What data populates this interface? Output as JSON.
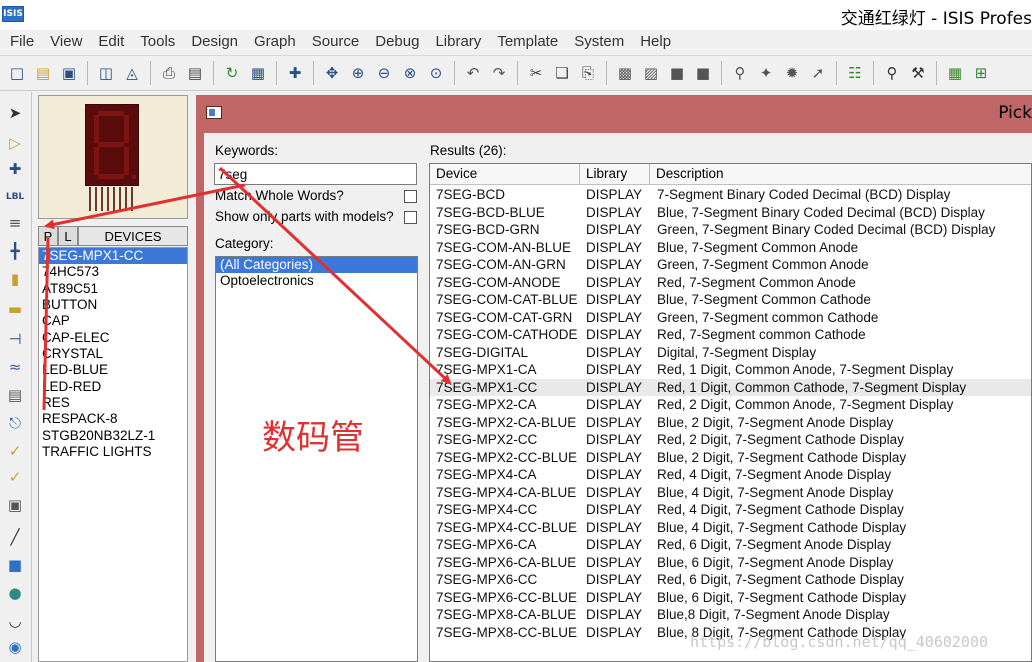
{
  "window": {
    "logo": "ISIS",
    "title": "交通红绿灯 - ISIS Profes"
  },
  "menu": [
    "File",
    "View",
    "Edit",
    "Tools",
    "Design",
    "Graph",
    "Source",
    "Debug",
    "Library",
    "Template",
    "System",
    "Help"
  ],
  "device_selector": {
    "tab_p": "P",
    "tab_l": "L",
    "header": "DEVICES",
    "items": [
      "7SEG-MPX1-CC",
      "74HC573",
      "AT89C51",
      "BUTTON",
      "CAP",
      "CAP-ELEC",
      "CRYSTAL",
      "LED-BLUE",
      "LED-RED",
      "RES",
      "RESPACK-8",
      "STGB20NB32LZ-1",
      "TRAFFIC LIGHTS"
    ],
    "selected_index": 0
  },
  "pick_dialog": {
    "title": "Pick",
    "keywords_label": "Keywords:",
    "keywords_value": "7seg",
    "match_whole_words_label": "Match Whole Words?",
    "match_whole_words_checked": false,
    "show_only_models_label": "Show only parts with models?",
    "show_only_models_checked": false,
    "category_label": "Category:",
    "categories": [
      "(All Categories)",
      "Optoelectronics"
    ],
    "selected_category_index": 0,
    "results_label": "Results (26):",
    "columns": [
      "Device",
      "Library",
      "Description"
    ],
    "highlighted_row_index": 11,
    "rows": [
      {
        "device": "7SEG-BCD",
        "library": "DISPLAY",
        "description": "7-Segment Binary Coded Decimal (BCD) Display"
      },
      {
        "device": "7SEG-BCD-BLUE",
        "library": "DISPLAY",
        "description": "Blue, 7-Segment Binary Coded Decimal (BCD) Display"
      },
      {
        "device": "7SEG-BCD-GRN",
        "library": "DISPLAY",
        "description": "Green, 7-Segment Binary Coded Decimal (BCD) Display"
      },
      {
        "device": "7SEG-COM-AN-BLUE",
        "library": "DISPLAY",
        "description": "Blue, 7-Segment Common Anode"
      },
      {
        "device": "7SEG-COM-AN-GRN",
        "library": "DISPLAY",
        "description": "Green, 7-Segment Common Anode"
      },
      {
        "device": "7SEG-COM-ANODE",
        "library": "DISPLAY",
        "description": "Red, 7-Segment Common Anode"
      },
      {
        "device": "7SEG-COM-CAT-BLUE",
        "library": "DISPLAY",
        "description": "Blue, 7-Segment Common Cathode"
      },
      {
        "device": "7SEG-COM-CAT-GRN",
        "library": "DISPLAY",
        "description": "Green, 7-Segment common Cathode"
      },
      {
        "device": "7SEG-COM-CATHODE",
        "library": "DISPLAY",
        "description": "Red, 7-Segment common Cathode"
      },
      {
        "device": "7SEG-DIGITAL",
        "library": "DISPLAY",
        "description": "Digital, 7-Segment Display"
      },
      {
        "device": "7SEG-MPX1-CA",
        "library": "DISPLAY",
        "description": "Red, 1 Digit, Common Anode, 7-Segment Display"
      },
      {
        "device": "7SEG-MPX1-CC",
        "library": "DISPLAY",
        "description": "Red, 1 Digit, Common Cathode, 7-Segment Display"
      },
      {
        "device": "7SEG-MPX2-CA",
        "library": "DISPLAY",
        "description": "Red, 2 Digit, Common Anode, 7-Segment Display"
      },
      {
        "device": "7SEG-MPX2-CA-BLUE",
        "library": "DISPLAY",
        "description": "Blue, 2 Digit, 7-Segment Anode Display"
      },
      {
        "device": "7SEG-MPX2-CC",
        "library": "DISPLAY",
        "description": "Red, 2 Digit, 7-Segment Cathode Display"
      },
      {
        "device": "7SEG-MPX2-CC-BLUE",
        "library": "DISPLAY",
        "description": "Blue, 2 Digit, 7-Segment Cathode Display"
      },
      {
        "device": "7SEG-MPX4-CA",
        "library": "DISPLAY",
        "description": "Red, 4 Digit, 7-Segment Anode Display"
      },
      {
        "device": "7SEG-MPX4-CA-BLUE",
        "library": "DISPLAY",
        "description": "Blue, 4 Digit, 7-Segment Anode Display"
      },
      {
        "device": "7SEG-MPX4-CC",
        "library": "DISPLAY",
        "description": "Red, 4 Digit, 7-Segment Cathode Display"
      },
      {
        "device": "7SEG-MPX4-CC-BLUE",
        "library": "DISPLAY",
        "description": "Blue, 4 Digit, 7-Segment Cathode Display"
      },
      {
        "device": "7SEG-MPX6-CA",
        "library": "DISPLAY",
        "description": "Red, 6 Digit, 7-Segment Anode Display"
      },
      {
        "device": "7SEG-MPX6-CA-BLUE",
        "library": "DISPLAY",
        "description": "Blue, 6 Digit, 7-Segment Anode Display"
      },
      {
        "device": "7SEG-MPX6-CC",
        "library": "DISPLAY",
        "description": "Red, 6 Digit, 7-Segment Cathode Display"
      },
      {
        "device": "7SEG-MPX6-CC-BLUE",
        "library": "DISPLAY",
        "description": "Blue, 6 Digit, 7-Segment Cathode Display"
      },
      {
        "device": "7SEG-MPX8-CA-BLUE",
        "library": "DISPLAY",
        "description": "Blue,8 Digit, 7-Segment Anode Display"
      },
      {
        "device": "7SEG-MPX8-CC-BLUE",
        "library": "DISPLAY",
        "description": "Blue, 8 Digit, 7-Segment Cathode Display"
      }
    ]
  },
  "annotation": {
    "text": "数码管",
    "color": "#e03030"
  },
  "watermark": "https://blog.csdn.net/qq_40602000",
  "colors": {
    "dialog_frame": "#c06666",
    "selection": "#3c78d8",
    "preview_bg": "#f2ecd6",
    "segment_off": "#7d1414"
  },
  "toolbar_icons": [
    "new-file-icon",
    "open-folder-icon",
    "save-icon",
    "import-icon",
    "export-icon",
    "print-icon",
    "page-setup-icon",
    "refresh-icon",
    "grid-icon",
    "origin-icon",
    "pan-icon",
    "zoom-in-icon",
    "zoom-out-icon",
    "zoom-all-icon",
    "zoom-area-icon",
    "undo-icon",
    "redo-icon",
    "cut-icon",
    "copy-icon",
    "paste-icon",
    "block-copy-icon",
    "block-move-icon",
    "block-rotate-icon",
    "block-delete-icon",
    "pick-device-icon",
    "make-device-icon",
    "packaging-icon",
    "decompose-icon",
    "wire-autorouter-icon",
    "search-tag-icon",
    "property-tool-icon",
    "netlist-icon",
    "bill-icon"
  ],
  "leftstrip_icons": [
    "selection-mode-icon",
    "component-mode-icon",
    "junction-dot-icon",
    "wire-label-icon",
    "text-script-icon",
    "bus-icon",
    "subcircuit-icon",
    "terminal-icon",
    "device-pin-icon",
    "graph-icon",
    "tape-recorder-icon",
    "generator-icon",
    "voltage-probe-icon",
    "current-probe-icon",
    "virtual-instrument-icon",
    "line-icon",
    "box-icon",
    "circle-icon",
    "arc-icon",
    "path-icon"
  ]
}
